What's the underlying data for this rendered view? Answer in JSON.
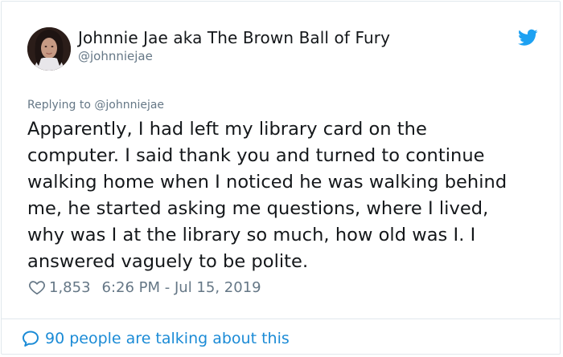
{
  "author": {
    "display_name": "Johnnie Jae aka The Brown Ball of Fury",
    "handle": "@johnniejae"
  },
  "tweet": {
    "replying_to": "Replying to @johnniejae",
    "lines": [
      "Apparently, I had left my library card on the",
      "computer. I said thank you and turned to continue",
      "walking home when I noticed he was walking behind",
      "me, he started asking me questions, where I lived,",
      "why was I at the library so much, how old was I. I",
      "answered vaguely to be polite."
    ],
    "likes": "1,853",
    "timestamp": "6:26 PM - Jul 15, 2019"
  },
  "footer": {
    "talking_label": "90 people are talking about this"
  },
  "icons": {
    "brand": "twitter-bird-icon",
    "like": "heart-icon",
    "reply": "speech-bubble-icon"
  },
  "colors": {
    "brand_blue": "#1da1f2",
    "link_blue": "#1b8bd6",
    "muted_text": "#657786",
    "primary_text": "#14171a",
    "border": "#e1e8ed"
  }
}
